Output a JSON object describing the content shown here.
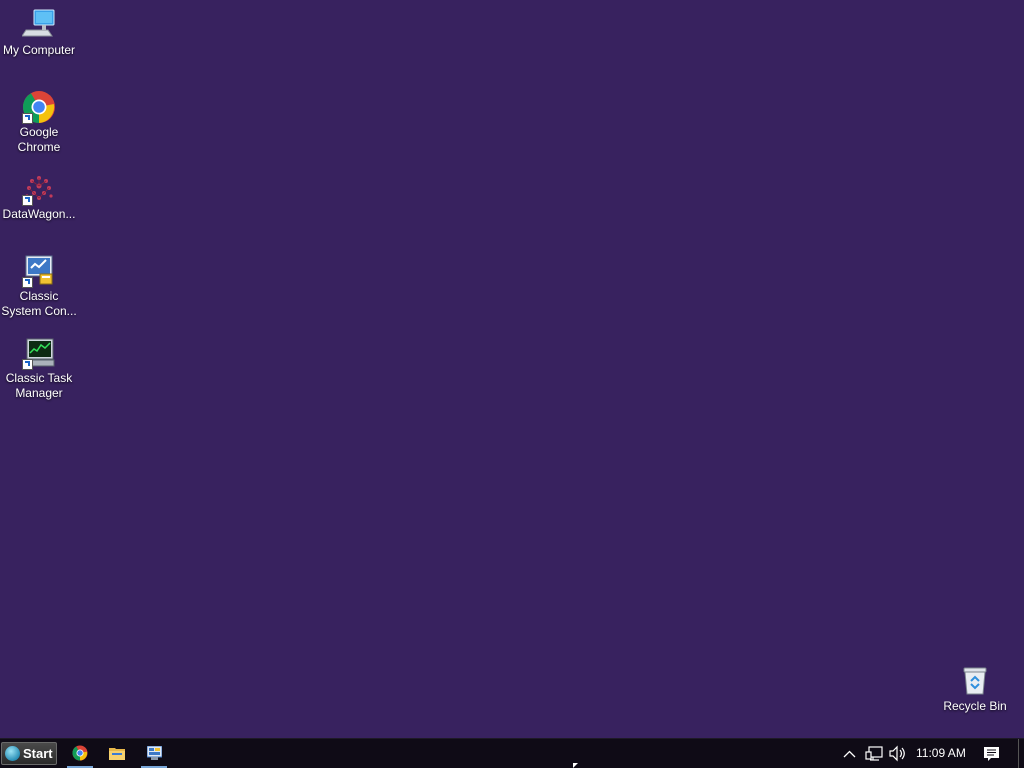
{
  "desktop": {
    "background_color": "#38225f",
    "icons": [
      {
        "label": "My Computer",
        "icon": "computer-icon"
      },
      {
        "label": "Google\nChrome",
        "icon": "chrome-icon"
      },
      {
        "label": "DataWagon...",
        "icon": "datawagon-icon"
      },
      {
        "label": "Classic\nSystem Con...",
        "icon": "system-config-icon"
      },
      {
        "label": "Classic Task\nManager",
        "icon": "task-manager-icon"
      },
      {
        "label": "Recycle Bin",
        "icon": "recycle-bin-icon"
      }
    ]
  },
  "taskbar": {
    "start_label": "Start",
    "pinned": [
      {
        "name": "chrome",
        "icon": "chrome-icon",
        "active": true
      },
      {
        "name": "file-explorer",
        "icon": "folder-icon",
        "active": false
      },
      {
        "name": "control-panel",
        "icon": "control-panel-icon",
        "active": true
      }
    ],
    "tray": {
      "clock": "11:09 AM",
      "icons": [
        "chevron-up-icon",
        "network-icon",
        "volume-icon",
        "notification-icon"
      ]
    }
  }
}
